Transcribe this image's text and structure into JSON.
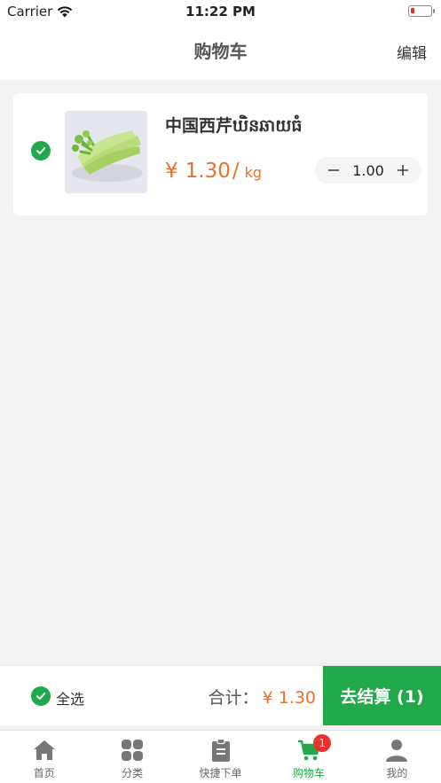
{
  "status_bar": {
    "carrier": "Carrier",
    "time": "11:22 PM"
  },
  "nav": {
    "title": "购物车",
    "edit_label": "编辑"
  },
  "cart": {
    "items": [
      {
        "name": "中国西芹ឃិនឆាយធំ",
        "currency": "¥",
        "price": "1.30",
        "unit_sep": "/",
        "unit": "kg",
        "quantity": "1.00",
        "checked": true
      }
    ]
  },
  "footer": {
    "select_all_label": "全选",
    "total_label": "合计：",
    "total_amount": "¥ 1.30",
    "checkout_label": "去结算 (1)"
  },
  "tabs": [
    {
      "label": "首页",
      "icon": "home-icon"
    },
    {
      "label": "分类",
      "icon": "category-grid-icon"
    },
    {
      "label": "快捷下单",
      "icon": "clipboard-icon"
    },
    {
      "label": "购物车",
      "icon": "cart-icon",
      "active": true,
      "badge": "1"
    },
    {
      "label": "我的",
      "icon": "user-icon"
    }
  ],
  "colors": {
    "accent": "#21a84b",
    "price": "#e8722d",
    "badge": "#e8322d",
    "background": "#f2f2f2"
  }
}
